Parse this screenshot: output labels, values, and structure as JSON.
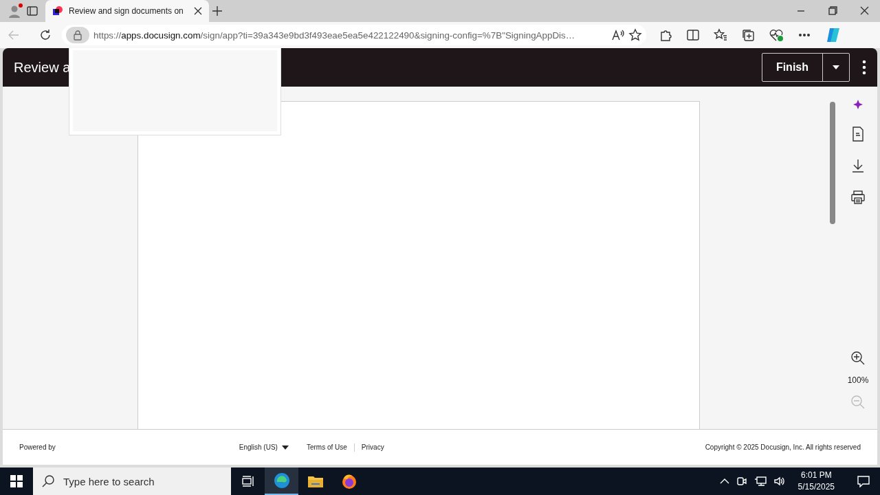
{
  "browser": {
    "tab_title": "Review and sign documents on",
    "url": {
      "scheme": "https://",
      "host": "apps.docusign.com",
      "path": "/sign/app?ti=39a343e9bd3f493eae5ea5e422122490&signing-config=%7B\"SigningAppDis…"
    }
  },
  "header": {
    "title": "Review a",
    "finish_button": "Finish"
  },
  "sidebar": {
    "zoom_level": "100%"
  },
  "footer": {
    "powered_by": "Powered by",
    "language": "English (US)",
    "links": [
      "Terms of Use",
      "Privacy"
    ],
    "copyright": "Copyright © 2025 Docusign, Inc. All rights reserved"
  },
  "taskbar": {
    "search_placeholder": "Type here to search",
    "time": "6:01 PM",
    "date": "5/15/2025"
  }
}
